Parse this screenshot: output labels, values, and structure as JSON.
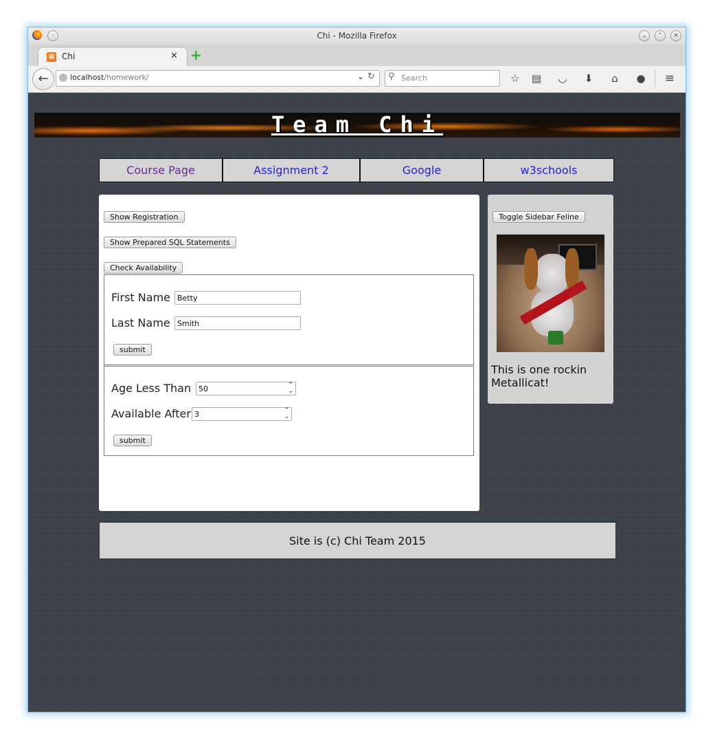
{
  "window": {
    "title": "Chi - Mozilla Firefox"
  },
  "tab": {
    "title": "Chi"
  },
  "navbar": {
    "url_host": "localhost",
    "url_path": "/homework/",
    "search_placeholder": "Search"
  },
  "site": {
    "title": "Team Chi",
    "nav": [
      "Course Page",
      "Assignment 2",
      "Google",
      "w3schools"
    ],
    "nav_visited_color": "#6a2a9a",
    "nav_link_color": "#2222dd"
  },
  "main": {
    "buttons": {
      "show_registration": "Show Registration",
      "show_sql": "Show Prepared SQL Statements",
      "check_availability": "Check Availability"
    },
    "name_form": {
      "first_name_label": "First Name",
      "first_name_value": "Betty",
      "last_name_label": "Last Name",
      "last_name_value": "Smith",
      "submit_label": "submit"
    },
    "age_form": {
      "age_label": "Age Less Than",
      "age_value": "50",
      "available_label": "Available After",
      "available_value": "3",
      "submit_label": "submit"
    }
  },
  "sidebar": {
    "toggle_label": "Toggle Sidebar Feline",
    "caption": "This is one rockin Metallicat!"
  },
  "footer": {
    "text": "Site is (c) Chi Team 2015"
  }
}
